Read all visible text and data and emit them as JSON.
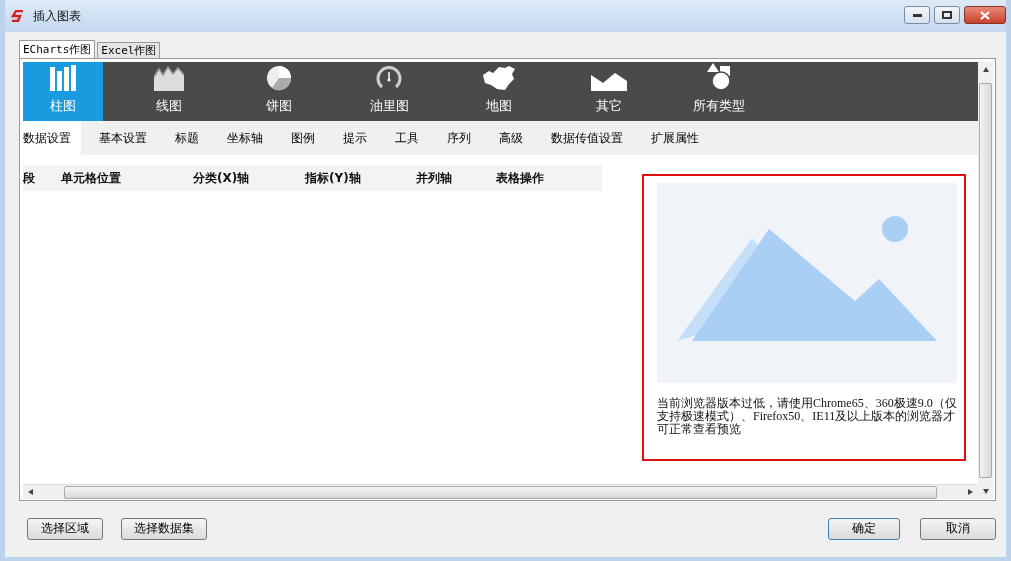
{
  "window": {
    "title": "插入图表"
  },
  "tabs": [
    {
      "label": "ECharts作图",
      "selected": true
    },
    {
      "label": "Excel作图",
      "selected": false
    }
  ],
  "chart_types": [
    {
      "label": "柱图",
      "kind": "bar",
      "selected": true
    },
    {
      "label": "线图",
      "kind": "line",
      "selected": false
    },
    {
      "label": "饼图",
      "kind": "pie",
      "selected": false
    },
    {
      "label": "油里图",
      "kind": "gauge",
      "selected": false
    },
    {
      "label": "地图",
      "kind": "map",
      "selected": false
    },
    {
      "label": "其它",
      "kind": "other",
      "selected": false
    },
    {
      "label": "所有类型",
      "kind": "all",
      "selected": false
    }
  ],
  "settings_tabs": [
    {
      "label": "数据设置",
      "selected": true
    },
    {
      "label": "基本设置",
      "selected": false
    },
    {
      "label": "标题",
      "selected": false
    },
    {
      "label": "坐标轴",
      "selected": false
    },
    {
      "label": "图例",
      "selected": false
    },
    {
      "label": "提示",
      "selected": false
    },
    {
      "label": "工具",
      "selected": false
    },
    {
      "label": "序列",
      "selected": false
    },
    {
      "label": "高级",
      "selected": false
    },
    {
      "label": "数据传值设置",
      "selected": false
    },
    {
      "label": "扩展属性",
      "selected": false
    }
  ],
  "table": {
    "columns": [
      "段",
      "单元格位置",
      "分类(X)轴",
      "指标(Y)轴",
      "并列轴",
      "表格操作"
    ]
  },
  "preview": {
    "message": "当前浏览器版本过低，请使用Chrome65、360极速9.0（仅支持极速模式）、Firefox50、IE11及以上版本的浏览器才可正常查看预览"
  },
  "buttons_left": [
    "选择区域",
    "选择数据集"
  ],
  "buttons_right": [
    "确定",
    "取消"
  ]
}
